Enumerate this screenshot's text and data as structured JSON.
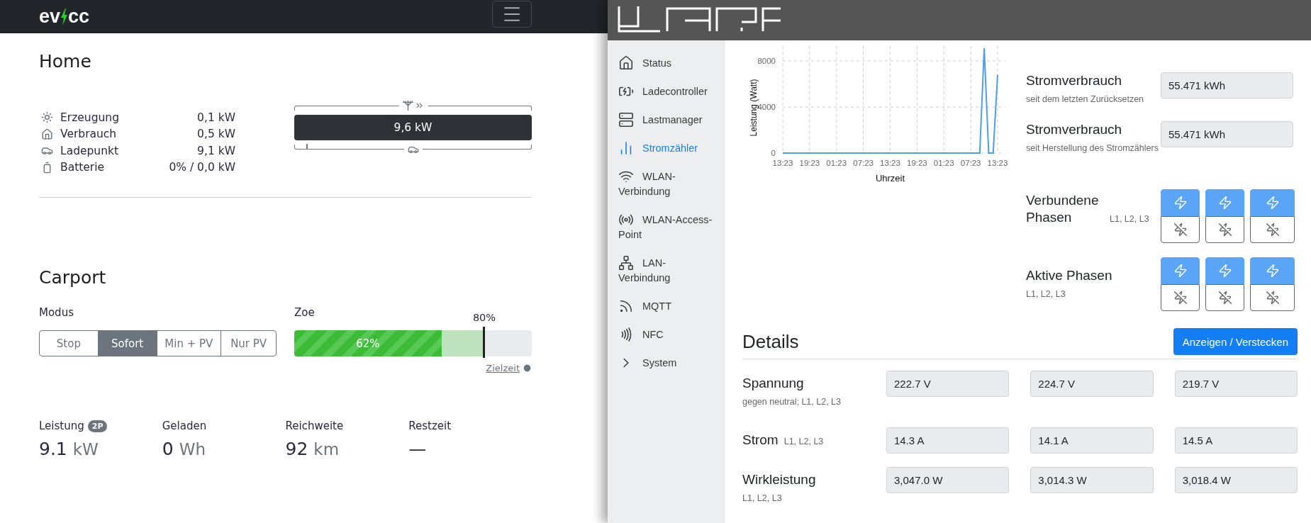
{
  "evcc": {
    "logo_text": [
      "ev",
      "cc"
    ],
    "home": {
      "title": "Home",
      "energy": [
        {
          "kind": "sun",
          "label": "Erzeugung",
          "value": "0,1 kW"
        },
        {
          "kind": "house",
          "label": "Verbrauch",
          "value": "0,5 kW"
        },
        {
          "kind": "car",
          "label": "Ladepunkt",
          "value": "9,1 kW"
        },
        {
          "kind": "battery",
          "label": "Batterie",
          "value": "0% / 0,0 kW"
        }
      ],
      "grid_bar": {
        "label": "9,6 kW"
      }
    },
    "loadpoint": {
      "title": "Carport",
      "mode_label": "Modus",
      "modes": [
        {
          "label": "Stop",
          "selected": false
        },
        {
          "label": "Sofort",
          "selected": true
        },
        {
          "label": "Min + PV",
          "selected": false
        },
        {
          "label": "Nur PV",
          "selected": false
        }
      ],
      "vehicle": {
        "name": "Zoe",
        "soc": {
          "label": "62%",
          "level": 0.62
        },
        "target": {
          "label": "80%",
          "level": 0.8
        },
        "target_time_link": "Zielzeit"
      },
      "stats": [
        {
          "label": "Leistung",
          "badge": "2P",
          "value": "9.1",
          "unit": "kW"
        },
        {
          "label": "Geladen",
          "value": "0",
          "unit": "Wh"
        },
        {
          "label": "Reichweite",
          "value": "92",
          "unit": "km"
        },
        {
          "label": "Restzeit",
          "value": "—"
        }
      ]
    }
  },
  "warp": {
    "nav": [
      {
        "kind": "home",
        "label": "Status",
        "selected": false
      },
      {
        "kind": "charger",
        "label": "Ladecontroller",
        "selected": false
      },
      {
        "kind": "server",
        "label": "Lastmanager",
        "selected": false
      },
      {
        "kind": "bars",
        "label": "Stromzähler",
        "selected": true
      },
      {
        "kind": "wifi",
        "label": "WLAN-Verbindung",
        "selected": false
      },
      {
        "kind": "broadcast",
        "label": "WLAN-Access-Point",
        "selected": false
      },
      {
        "kind": "network",
        "label": "LAN-Verbindung",
        "selected": false
      },
      {
        "kind": "rss",
        "label": "MQTT",
        "selected": false
      },
      {
        "kind": "nfc",
        "label": "NFC",
        "selected": false
      },
      {
        "kind": "chevron",
        "label": "System",
        "selected": false
      }
    ],
    "chart": {
      "chart_data": {
        "type": "line",
        "xlabel": "Uhrzeit",
        "ylabel": "Leistung (Watt)",
        "categories": [
          "13:23",
          null,
          null,
          null,
          null,
          null,
          "19:23",
          null,
          null,
          null,
          null,
          null,
          "01:23",
          null,
          null,
          null,
          null,
          null,
          "07:23",
          null,
          null,
          null,
          null,
          null,
          "13:23",
          null,
          null,
          null,
          null,
          null,
          "19:23",
          null,
          null,
          null,
          null,
          null,
          "01:23",
          null,
          null,
          null,
          null,
          null,
          "07:23",
          null,
          null,
          null,
          null,
          null,
          "13:23"
        ],
        "grid": true,
        "series": [
          {
            "color": "#4d9df5",
            "values": [
              0,
              0,
              0,
              0,
              0,
              0,
              0,
              0,
              0,
              0,
              0,
              0,
              0,
              0,
              0,
              0,
              0,
              0,
              0,
              0,
              0,
              0,
              0,
              0,
              0,
              0,
              0,
              0,
              0,
              0,
              0,
              0,
              0,
              0,
              0,
              0,
              0,
              0,
              0,
              0,
              0,
              0,
              0,
              0,
              0,
              9100,
              0,
              0,
              6800
            ]
          }
        ],
        "ylim": [
          0,
          9300
        ],
        "yticks": [
          0,
          4000,
          8000
        ]
      }
    },
    "meters": [
      {
        "label": "Stromverbrauch",
        "note": "seit dem letzten Zurücksetzen",
        "value": "55.471 kWh"
      },
      {
        "label": "Stromverbrauch",
        "note": "seit Herstellung des Stromzählers",
        "value": "55.471 kWh"
      }
    ],
    "phase_groups": [
      {
        "label": "Verbundene Phasen",
        "note": "L1, L2, L3",
        "note_below": false,
        "phases": [
          {
            "connected": true
          },
          {
            "connected": true
          },
          {
            "connected": true
          }
        ]
      },
      {
        "label": "Aktive Phasen",
        "note": "L1, L2, L3",
        "note_below": true,
        "phases": [
          {
            "connected": true
          },
          {
            "connected": true
          },
          {
            "connected": true
          }
        ]
      }
    ],
    "details": {
      "title": "Details",
      "toggle_button": "Anzeigen / Verstecken",
      "rows": [
        {
          "label": "Spannung",
          "note": "gegen neutral; L1, L2, L3",
          "note_below": true,
          "values": [
            "222.7 V",
            "224.7 V",
            "219.7 V"
          ]
        },
        {
          "label": "Strom",
          "note": "L1, L2, L3",
          "note_below": false,
          "values": [
            "14.3 A",
            "14.1 A",
            "14.5 A"
          ]
        },
        {
          "label": "Wirkleistung",
          "note": "L1, L2, L3",
          "note_below": true,
          "values": [
            "3,047.0 W",
            "3,014.3 W",
            "3,018.4 W"
          ]
        }
      ]
    }
  }
}
